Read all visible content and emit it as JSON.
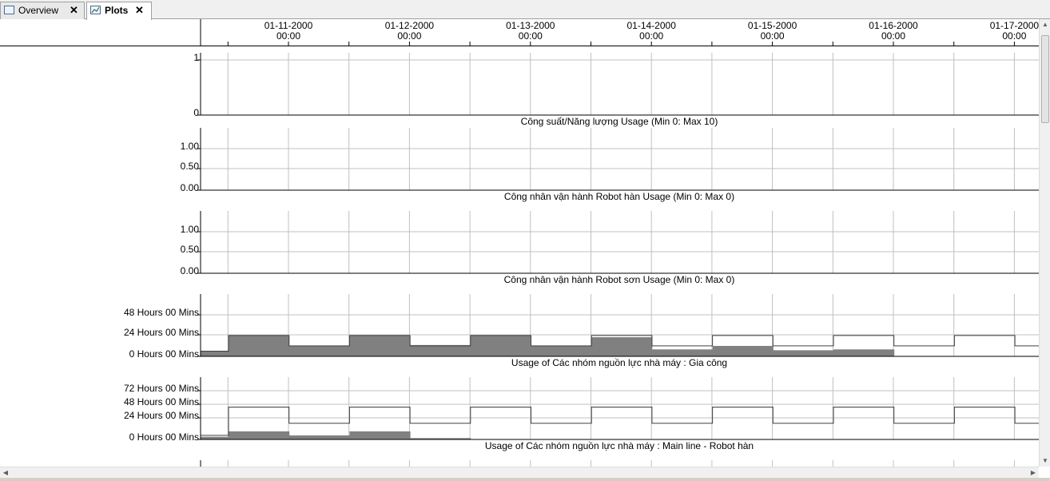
{
  "tabs": [
    {
      "label": "Overview",
      "active": false,
      "icon": "overview-icon"
    },
    {
      "label": "Plots",
      "active": true,
      "icon": "chart-icon"
    }
  ],
  "close_glyph": "✕",
  "time_axis": [
    {
      "date": "01-11-2000",
      "time": "00:00"
    },
    {
      "date": "01-12-2000",
      "time": "00:00"
    },
    {
      "date": "01-13-2000",
      "time": "00:00"
    },
    {
      "date": "01-14-2000",
      "time": "00:00"
    },
    {
      "date": "01-15-2000",
      "time": "00:00"
    },
    {
      "date": "01-16-2000",
      "time": "00:00"
    },
    {
      "date": "01-17-2000",
      "time": "00:00"
    }
  ],
  "colors": {
    "fill": "#808080",
    "grid": "#c0c0c0",
    "axis": "#000000"
  },
  "chart_data": [
    {
      "type": "area",
      "title": "Công suất/Năng lượng Usage (Min 0: Max 10)",
      "y_ticks": [
        "1",
        "0"
      ],
      "capacity": [],
      "usage": []
    },
    {
      "type": "area",
      "title": "Công nhân vận hành Robot hàn Usage (Min 0: Max 0)",
      "y_ticks": [
        "1.00",
        "0.50",
        "0.00"
      ],
      "capacity": [],
      "usage": []
    },
    {
      "type": "area",
      "title": "Công nhân vận hành Robot sơn Usage (Min 0: Max 0)",
      "y_ticks": [
        "1.00",
        "0.50",
        "0.00"
      ],
      "capacity": [],
      "usage": []
    },
    {
      "type": "area",
      "title": "Usage of Các nhóm nguồn lực nhà máy : Gia công",
      "y_ticks": [
        "48 Hours 00 Mins",
        "24 Hours 00 Mins",
        "0 Hours 00 Mins"
      ],
      "y_max_hours": 48,
      "capacity": [
        6,
        24,
        12,
        24,
        12,
        24,
        12,
        24,
        12,
        24,
        12,
        24,
        12,
        24,
        12
      ],
      "usage": [
        6,
        24,
        12,
        24,
        13,
        24,
        12,
        22,
        8,
        12,
        7,
        8,
        0,
        0,
        0
      ]
    },
    {
      "type": "area",
      "title": "Usage of Các nhóm nguồn lực nhà máy : Main line - Robot hàn",
      "y_ticks": [
        "72 Hours 00 Mins",
        "48 Hours 00 Mins",
        "24 Hours 00 Mins",
        "0 Hours 00 Mins"
      ],
      "y_max_hours": 72,
      "capacity": [
        6,
        48,
        24,
        48,
        24,
        48,
        24,
        48,
        24,
        48,
        24,
        48,
        24,
        48,
        24
      ],
      "usage": [
        4,
        12,
        6,
        12,
        2,
        0,
        0,
        0,
        0,
        0,
        0,
        0,
        0,
        0,
        0
      ]
    }
  ]
}
